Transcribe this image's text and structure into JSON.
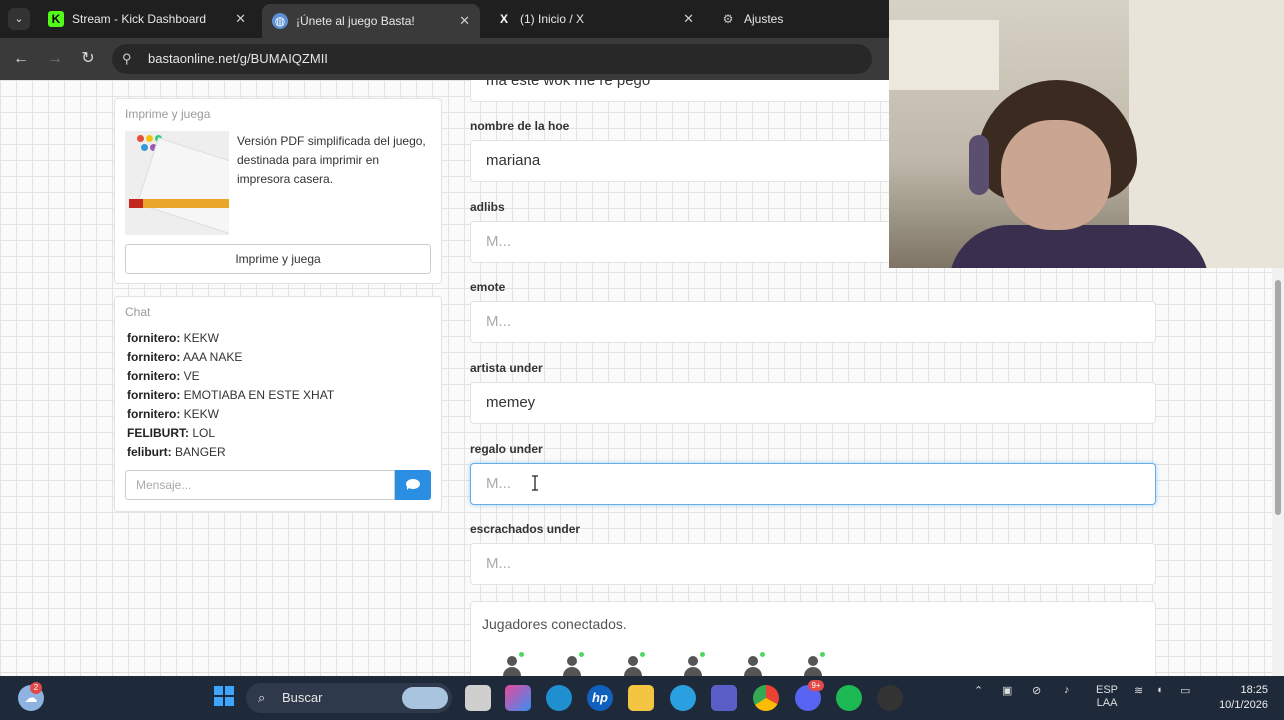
{
  "browser": {
    "tabs": [
      {
        "label": "Stream - Kick Dashboard",
        "icon": "kick-icon"
      },
      {
        "label": "¡Únete al juego Basta!",
        "icon": "globe-icon"
      },
      {
        "label": "(1) Inicio / X",
        "icon": "x-icon"
      },
      {
        "label": "Ajustes",
        "icon": "gear-icon"
      }
    ],
    "url": "bastaonline.net/g/BUMAIQZMII"
  },
  "print_card": {
    "title": "Imprime y juega",
    "description": "Versión PDF simplificada del juego, destinada para imprimir en impresora casera.",
    "button_label": "Imprime y juega"
  },
  "chat": {
    "title": "Chat",
    "messages": [
      {
        "user": "fornitero:",
        "text": "KEKW"
      },
      {
        "user": "fornitero:",
        "text": "AAA NAKE"
      },
      {
        "user": "fornitero:",
        "text": "VE"
      },
      {
        "user": "fornitero:",
        "text": "EMOTIABA EN ESTE XHAT"
      },
      {
        "user": "fornitero:",
        "text": "KEKW"
      },
      {
        "user": "FELIBURT:",
        "text": "LOL"
      },
      {
        "user": "feliburt:",
        "text": "BANGER"
      }
    ],
    "input_placeholder": "Mensaje..."
  },
  "form": {
    "top_partial_value": "ma este wok me re pego",
    "fields": [
      {
        "label": "nombre de la hoe",
        "value": "mariana",
        "placeholder": ""
      },
      {
        "label": "adlibs",
        "value": "",
        "placeholder": "M..."
      },
      {
        "label": "emote",
        "value": "",
        "placeholder": "M..."
      },
      {
        "label": "artista under",
        "value": "memey",
        "placeholder": ""
      },
      {
        "label": "regalo under",
        "value": "",
        "placeholder": "M..."
      },
      {
        "label": "escrachados under",
        "value": "",
        "placeholder": "M..."
      }
    ]
  },
  "players": {
    "title": "Jugadores conectados.",
    "count": 6
  },
  "taskbar": {
    "search_label": "Buscar",
    "notification_badge": "2",
    "discord_badge": "9+",
    "language": "ESP",
    "language_sub": "LAA",
    "time": "18:25",
    "date": "10/1/2026"
  }
}
